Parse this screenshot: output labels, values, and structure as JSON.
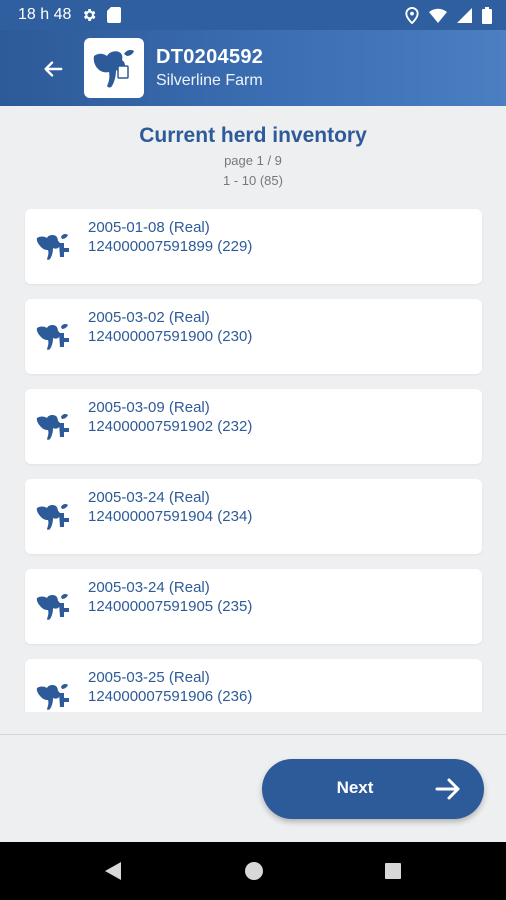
{
  "status_bar": {
    "time": "18 h 48",
    "icons_left": [
      "gear-icon",
      "sd-card-icon"
    ],
    "icons_right": [
      "location-icon",
      "wifi-icon",
      "signal-icon",
      "battery-icon"
    ]
  },
  "app_bar": {
    "title": "DT0204592",
    "subtitle": "Silverline Farm",
    "back_icon": "arrow-left-icon"
  },
  "inventory": {
    "heading": "Current herd inventory",
    "page_info": "page 1 / 9",
    "range_info": "1 - 10 (85)"
  },
  "animals": [
    {
      "line1": "2005-01-08 (Real)",
      "line2": "124000007591899 (229)"
    },
    {
      "line1": "2005-03-02 (Real)",
      "line2": "124000007591900 (230)"
    },
    {
      "line1": "2005-03-09 (Real)",
      "line2": "124000007591902 (232)"
    },
    {
      "line1": "2005-03-24 (Real)",
      "line2": "124000007591904 (234)"
    },
    {
      "line1": "2005-03-24 (Real)",
      "line2": "124000007591905 (235)"
    },
    {
      "line1": "2005-03-25 (Real)",
      "line2": "124000007591906 (236)"
    }
  ],
  "footer": {
    "next_label": "Next"
  },
  "colors": {
    "primary": "#2d5a98",
    "background": "#eeeff1",
    "card": "#ffffff"
  }
}
